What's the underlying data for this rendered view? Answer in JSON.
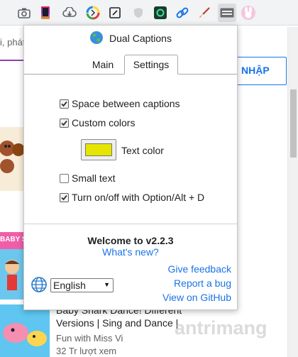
{
  "toolbar": {
    "icons": [
      "camera-icon",
      "gradient-extension-icon",
      "cloud-download-icon",
      "color-wheel-icon",
      "edit-square-icon",
      "shield-icon",
      "screen-record-icon",
      "link-icon",
      "paintbrush-icon",
      "dual-captions-extension-icon",
      "bunny-avatar-icon"
    ]
  },
  "background": {
    "address_fragment": "i, phát",
    "sign_in_button": "NHẬP",
    "thumb_label": "BABY S",
    "video_title_line1": "Baby Shark Dance! Different",
    "video_title_line2": "Versions | Sing and Dance |",
    "video_channel": "Fun with Miss Vi",
    "video_views": "32 Tr lượt xem",
    "watermark": "antrimang"
  },
  "popup": {
    "title": "Dual Captions",
    "tabs": [
      {
        "label": "Main",
        "active": false
      },
      {
        "label": "Settings",
        "active": true
      }
    ],
    "options": [
      {
        "label": "Space between captions",
        "checked": true
      },
      {
        "label": "Custom colors",
        "checked": true
      },
      {
        "label": "Small text",
        "checked": false
      },
      {
        "label": "Turn on/off with Option/Alt + D",
        "checked": true
      }
    ],
    "text_color_label": "Text color",
    "text_color_value": "#e5e500",
    "welcome": "Welcome to v2.2.3",
    "whats_new": "What's new?",
    "links": {
      "feedback": "Give feedback",
      "bug": "Report a bug",
      "github": "View on GitHub"
    },
    "language": {
      "selected": "English"
    }
  }
}
